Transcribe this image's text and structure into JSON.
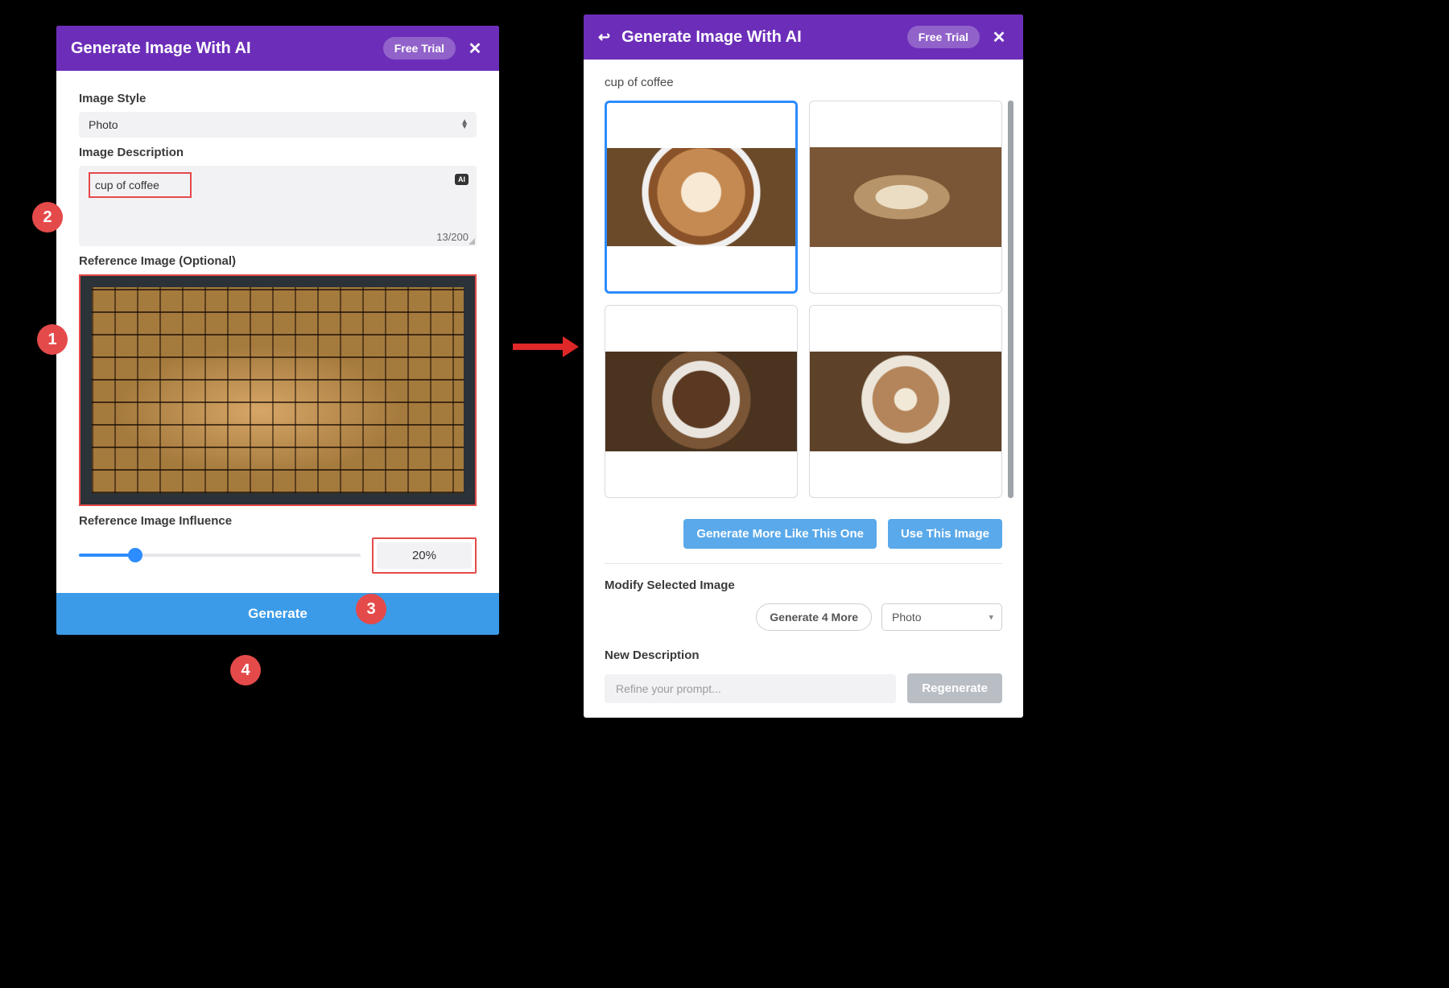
{
  "left": {
    "header": {
      "title": "Generate Image With AI",
      "free_trial": "Free Trial"
    },
    "style_label": "Image Style",
    "style_value": "Photo",
    "desc_label": "Image Description",
    "desc_value": "cup of coffee",
    "ai_badge": "AI",
    "char_count": "13/200",
    "ref_label": "Reference Image (Optional)",
    "influence_label": "Reference Image Influence",
    "influence_value": "20%",
    "generate": "Generate"
  },
  "callouts": {
    "c1": "1",
    "c2": "2",
    "c3": "3",
    "c4": "4"
  },
  "right": {
    "header": {
      "title": "Generate Image With AI",
      "free_trial": "Free Trial"
    },
    "prompt_echo": "cup of coffee",
    "gen_more": "Generate More Like This One",
    "use_this": "Use This Image",
    "modify_title": "Modify Selected Image",
    "gen4": "Generate 4 More",
    "style_value": "Photo",
    "new_desc_label": "New Description",
    "refine_placeholder": "Refine your prompt...",
    "regenerate": "Regenerate"
  }
}
